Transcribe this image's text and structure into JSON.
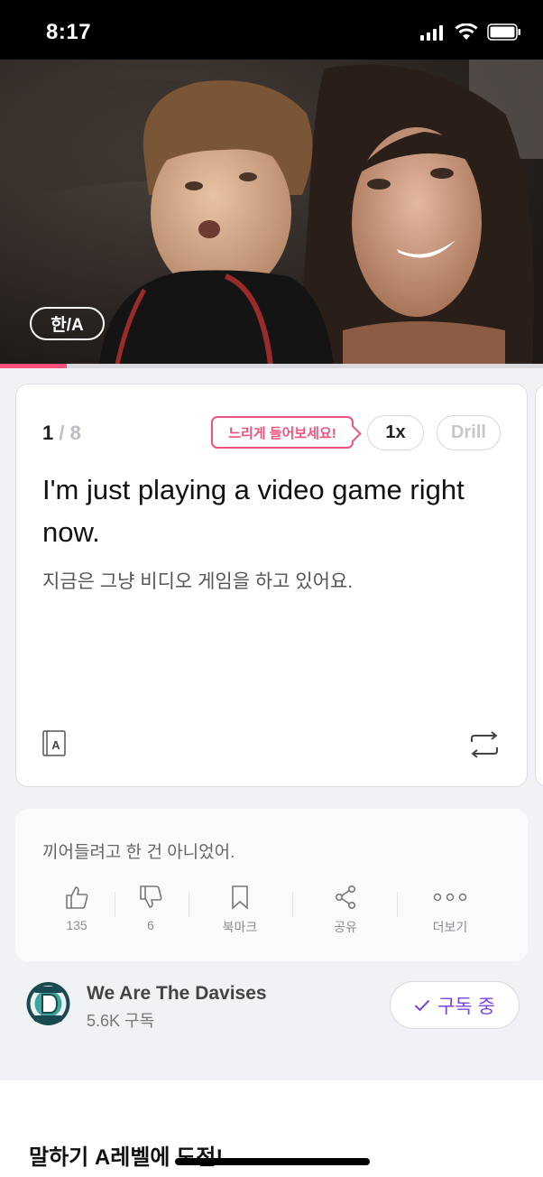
{
  "status_bar": {
    "time": "8:17"
  },
  "video": {
    "lang_toggle": "한/A",
    "progress": 0.123
  },
  "card": {
    "index": "1",
    "total": "8",
    "counter_sep": "/",
    "tip": "느리게 들어보세요!",
    "speed": "1x",
    "drill": "Drill",
    "sentence_en": "I'm just playing a video game right now.",
    "sentence_ko": "지금은 그냥 비디오 게임을 하고 있어요.",
    "dict_letter": "A"
  },
  "info": {
    "next_line": "끼어들려고 한 건 아니었어.",
    "actions": [
      {
        "icon": "thumbs-up-icon",
        "label": "135"
      },
      {
        "icon": "thumbs-down-icon",
        "label": "6"
      },
      {
        "icon": "bookmark-icon",
        "label": "북마크"
      },
      {
        "icon": "share-icon",
        "label": "공유"
      },
      {
        "icon": "more-icon",
        "label": "더보기"
      }
    ]
  },
  "channel": {
    "name": "We Are The Davises",
    "subscribers": "5.6K 구독",
    "subscribe_label": "구독 중",
    "accent": "#7a45e0"
  },
  "section": {
    "title": "말하기 A레벨에 도전!"
  },
  "colors": {
    "pink": "#f0527e",
    "progress": "#ff4f7b",
    "purple": "#7a45e0"
  }
}
